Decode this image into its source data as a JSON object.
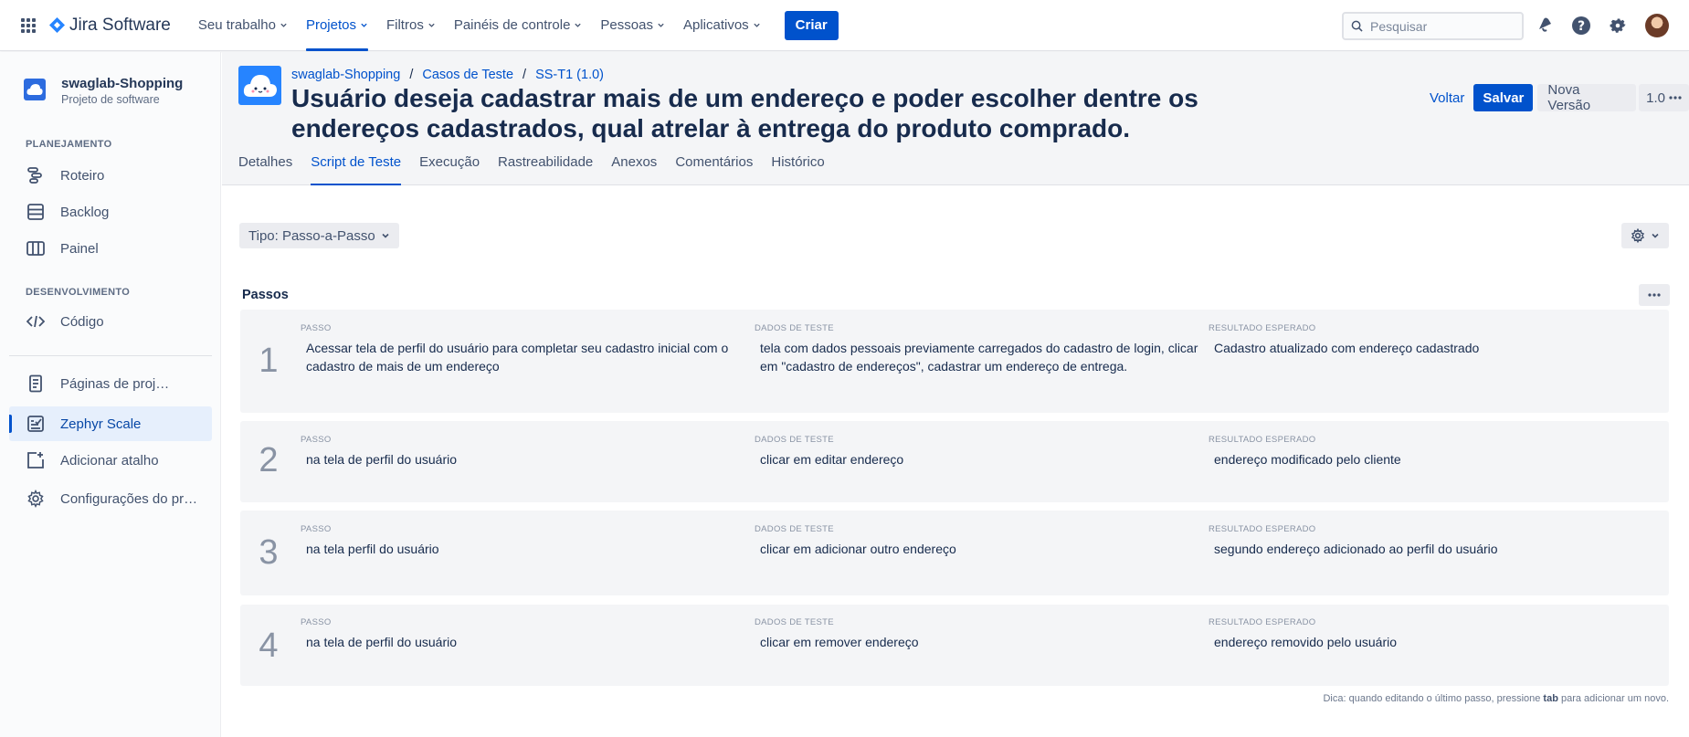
{
  "app": {
    "name": "Jira Software"
  },
  "topnav": {
    "items": [
      {
        "label": "Seu trabalho"
      },
      {
        "label": "Projetos"
      },
      {
        "label": "Filtros"
      },
      {
        "label": "Painéis de controle"
      },
      {
        "label": "Pessoas"
      },
      {
        "label": "Aplicativos"
      }
    ],
    "create_label": "Criar",
    "search_placeholder": "Pesquisar"
  },
  "sidebar": {
    "project_name": "swaglab-Shopping",
    "project_type": "Projeto de software",
    "planning_title": "PLANEJAMENTO",
    "dev_title": "DESENVOLVIMENTO",
    "items": [
      {
        "label": "Roteiro"
      },
      {
        "label": "Backlog"
      },
      {
        "label": "Painel"
      },
      {
        "label": "Código"
      },
      {
        "label": "Páginas de proj…"
      },
      {
        "label": "Zephyr Scale"
      },
      {
        "label": "Adicionar atalho"
      },
      {
        "label": "Configurações do pr…"
      }
    ]
  },
  "header": {
    "breadcrumbs": [
      "swaglab-Shopping",
      "Casos de Teste",
      "SS-T1 (1.0)"
    ],
    "title": "Usuário deseja cadastrar mais de um endereço e poder escolher dentre os endereços cadastrados, qual atrelar à entrega do produto comprado.",
    "back_label": "Voltar",
    "save_label": "Salvar",
    "new_version_label": "Nova Versão",
    "version_label": "1.0"
  },
  "tabs": [
    {
      "label": "Detalhes"
    },
    {
      "label": "Script de Teste"
    },
    {
      "label": "Execução"
    },
    {
      "label": "Rastreabilidade"
    },
    {
      "label": "Anexos"
    },
    {
      "label": "Comentários"
    },
    {
      "label": "Histórico"
    }
  ],
  "content": {
    "type_label": "Tipo: Passo-a-Passo",
    "steps_title": "Passos",
    "col_step": "PASSO",
    "col_data": "DADOS DE TESTE",
    "col_result": "RESULTADO ESPERADO",
    "steps": [
      {
        "n": "1",
        "step": "Acessar tela de perfil do usuário para completar seu cadastro inicial com o cadastro de mais de um endereço",
        "data": "tela com dados pessoais previamente carregados do cadastro de login, clicar em \"cadastro de endereços\", cadastrar um endereço de entrega.",
        "result": "Cadastro atualizado com endereço cadastrado"
      },
      {
        "n": "2",
        "step": "na tela de perfil do usuário",
        "data": "clicar em editar endereço",
        "result": "endereço modificado pelo cliente"
      },
      {
        "n": "3",
        "step": "na tela perfil do usuário",
        "data": "clicar em adicionar outro endereço",
        "result": "segundo endereço adicionado ao perfil do usuário"
      },
      {
        "n": "4",
        "step": "na tela de perfil do usuário",
        "data": "clicar em remover endereço",
        "result": "endereço removido pelo usuário"
      }
    ],
    "hint_pre": "Dica: quando editando o último passo, pressione",
    "hint_key": "tab",
    "hint_post": "para adicionar um novo."
  }
}
